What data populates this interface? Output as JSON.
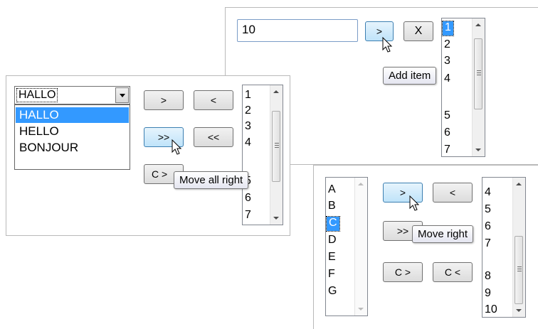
{
  "panel1": {
    "textbox_value": "10",
    "add_label": ">",
    "clear_label": "X",
    "list_items": [
      "1",
      "2",
      "3",
      "4",
      "5",
      "6",
      "7"
    ],
    "selected_index": 0,
    "tooltip": "Add item"
  },
  "panel2": {
    "combo_value": "HALLO",
    "dropdown_options": [
      "HALLO",
      "HELLO",
      "BONJOUR"
    ],
    "move_right_label": ">",
    "move_left_label": "<",
    "move_all_right_label": ">>",
    "move_all_left_label": "<<",
    "copy_right_label": "C >",
    "list_items": [
      "1",
      "2",
      "3",
      "4",
      "5",
      "6",
      "7"
    ],
    "tooltip": "Move all right"
  },
  "panel3": {
    "left_list": [
      "A",
      "B",
      "C",
      "D",
      "E",
      "F",
      "G"
    ],
    "selected_index": 2,
    "move_right_label": ">",
    "move_left_label": "<",
    "move_all_right_label": ">>",
    "copy_right_label": "C >",
    "copy_left_label": "C <",
    "right_list": [
      "4",
      "5",
      "6",
      "7",
      "8",
      "9",
      "10"
    ],
    "tooltip": "Move right"
  },
  "colors": {
    "selection": "#3399ff",
    "hot_button": "#bfe3f9",
    "panel_border": "#b9b9b9"
  }
}
